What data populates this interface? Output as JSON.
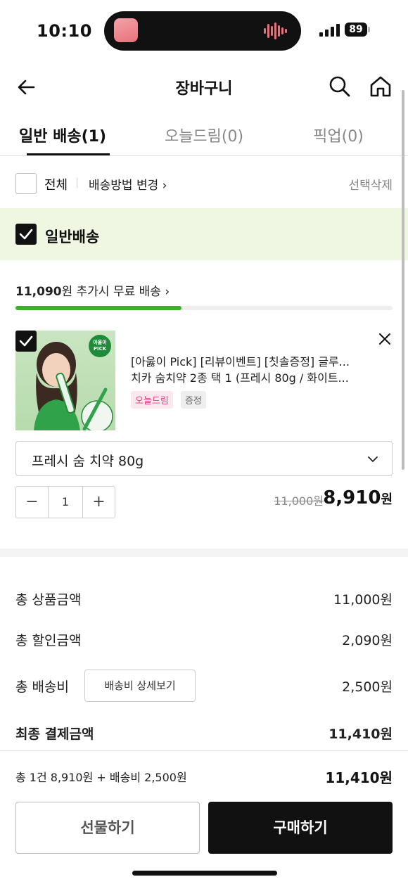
{
  "status_bar": {
    "time": "10:10",
    "battery": "89"
  },
  "header": {
    "title": "장바구니",
    "back_icon": "arrow-left-icon",
    "search_icon": "search-icon",
    "home_icon": "home-icon"
  },
  "tabs": [
    {
      "label": "일반 배송(1)",
      "active": true
    },
    {
      "label": "오늘드림(0)",
      "active": false
    },
    {
      "label": "픽업(0)",
      "active": false
    }
  ],
  "select_row": {
    "all_label": "전체",
    "change_method": "배송방법 변경 ›",
    "delete_selected": "선택삭제"
  },
  "group": {
    "label": "일반배송",
    "checked": true
  },
  "free_shipping": {
    "amount": "11,090",
    "text": "원 추가시 무료 배송 ›",
    "progress": 0.44,
    "color": "#3cb22b"
  },
  "product": {
    "checked": true,
    "image_badge": "아율이 PICK",
    "title_line1": "[아욿이 Pick] [리뷰이벤트] [칫솔증정] 글루...",
    "title_line2": "치카 숨치약 2종 택 1 (프레시 80g / 화이트...",
    "badges": [
      "오늘드림",
      "증정"
    ],
    "option": "프레시 숨 치약 80g",
    "quantity": "1",
    "minus": "−",
    "plus": "+",
    "original_price": "11,000원",
    "price": "8,910",
    "price_unit": "원"
  },
  "summary": {
    "total_product_label": "총 상품금액",
    "total_product_value": "11,000원",
    "discount_label": "총 할인금액",
    "discount_value": "2,090원",
    "shipping_label": "총 배송비",
    "shipping_detail_button": "배송비 상세보기",
    "shipping_value": "2,500원",
    "final_label": "최종 결제금액",
    "final_value": "11,410원"
  },
  "bottom_bar": {
    "summary_line": "총 1건 8,910원 + 배송비 2,500원",
    "total": "11,410원",
    "gift_button": "선물하기",
    "buy_button": "구매하기"
  }
}
